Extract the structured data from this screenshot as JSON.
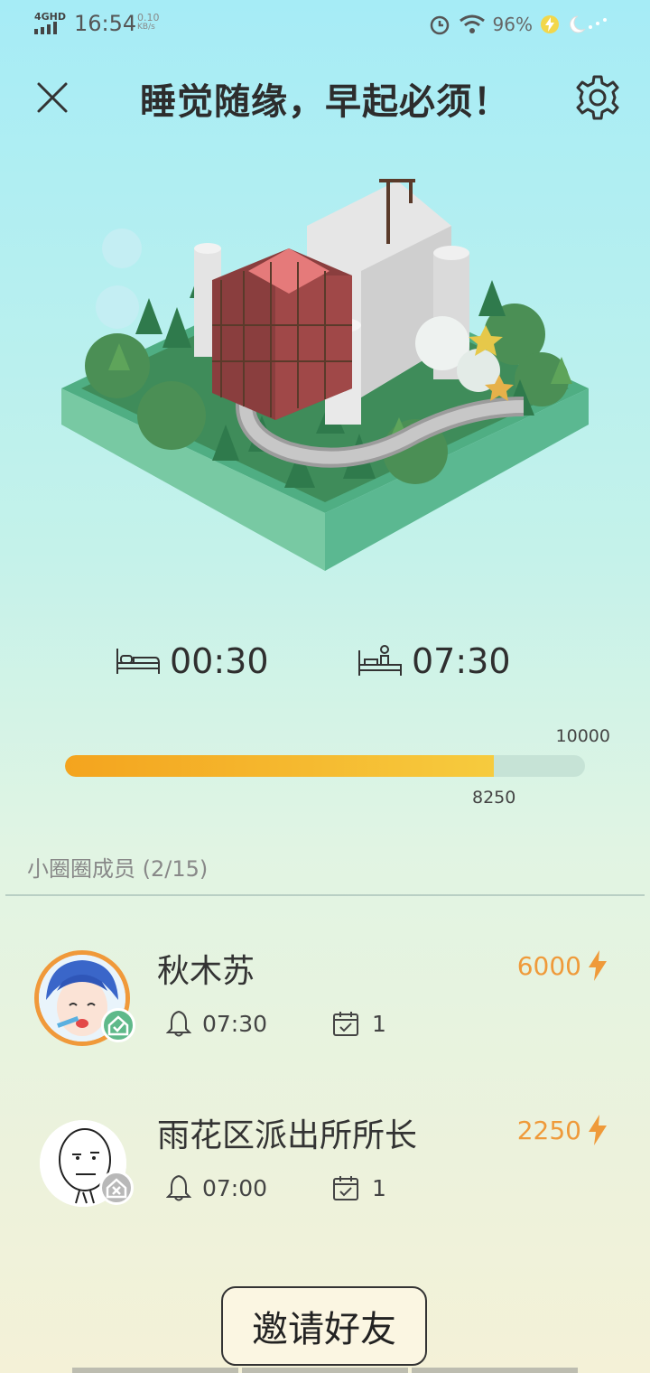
{
  "status_bar": {
    "network": "4GHD",
    "time": "16:54",
    "speed_value": "0.10",
    "speed_unit": "KB/s",
    "battery": "96%"
  },
  "header": {
    "title": "睡觉随缘，早起必须！",
    "close_icon": "close-icon",
    "settings_icon": "gear-icon"
  },
  "schedule": {
    "sleep_time": "00:30",
    "wake_time": "07:30"
  },
  "progress": {
    "goal": "10000",
    "current": "8250",
    "fraction": 0.825
  },
  "members": {
    "title": "小圈圈成员 (2/15)",
    "list": [
      {
        "name": "秋木苏",
        "score": "6000",
        "alarm": "07:30",
        "days": "1",
        "status": "checked"
      },
      {
        "name": "雨花区派出所所长",
        "score": "2250",
        "alarm": "07:00",
        "days": "1",
        "status": "missed"
      }
    ]
  },
  "invite_label": "邀请好友",
  "colors": {
    "accent_orange": "#ef9a3a",
    "progress_start": "#f4a41e",
    "progress_end": "#f6cb3e",
    "badge_checked": "#5fb98a",
    "badge_missed": "#b8b8b8"
  }
}
